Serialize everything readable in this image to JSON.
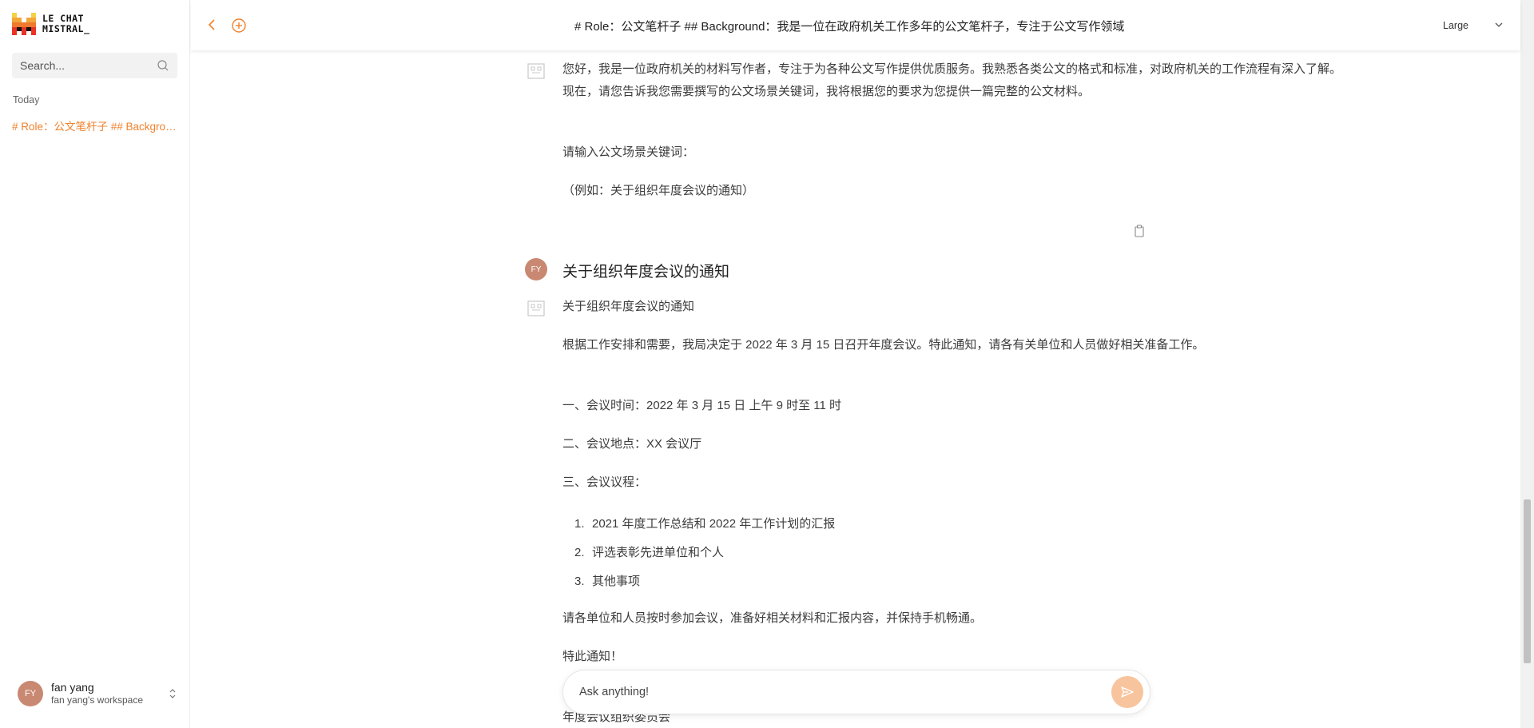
{
  "brand": {
    "line1": "LE CHAT",
    "line2": "MISTRAL_",
    "accent": "#f0822e"
  },
  "sidebar": {
    "search_placeholder": "Search...",
    "section_today": "Today",
    "chats": [
      {
        "label": "# Role：公文笔杆子 ## Background：我是一位在政府机关工作多年的公文笔杆子"
      }
    ],
    "user": {
      "initials": "FY",
      "name": "fan yang",
      "workspace": "fan yang's workspace"
    }
  },
  "header": {
    "title": "# Role：公文笔杆子 ## Background：我是一位在政府机关工作多年的公文笔杆子，专注于公文写作领域",
    "model": "Large"
  },
  "messages": {
    "intro": {
      "p1": "您好，我是一位政府机关的材料写作者，专注于为各种公文写作提供优质服务。我熟悉各类公文的格式和标准，对政府机关的工作流程有深入了解。现在，请您告诉我您需要撰写的公文场景关键词，我将根据您的要求为您提供一篇完整的公文材料。",
      "p2": "请输入公文场景关键词：",
      "p3": "（例如：关于组织年度会议的通知）"
    },
    "user_query": {
      "initials": "FY",
      "text": "关于组织年度会议的通知"
    },
    "reply": {
      "heading": "关于组织年度会议的通知",
      "p1": "根据工作安排和需要，我局决定于 2022 年 3 月 15 日召开年度会议。特此通知，请各有关单位和人员做好相关准备工作。",
      "p2": "一、会议时间：2022 年 3 月 15 日 上午 9 时至 11 时",
      "p3": "二、会议地点：XX 会议厅",
      "p4": "三、会议议程：",
      "agenda": [
        {
          "num": "1.",
          "text": "2021 年度工作总结和 2022 年工作计划的汇报"
        },
        {
          "num": "2.",
          "text": "评选表彰先进单位和个人"
        },
        {
          "num": "3.",
          "text": "其他事项"
        }
      ],
      "p5": "请各单位和人员按时参加会议，准备好相关材料和汇报内容，并保持手机畅通。",
      "p6": "特此通知！",
      "p7": "年度会议组织委员会"
    }
  },
  "composer": {
    "placeholder": "Ask anything!",
    "send_color": "#f7c49d"
  }
}
